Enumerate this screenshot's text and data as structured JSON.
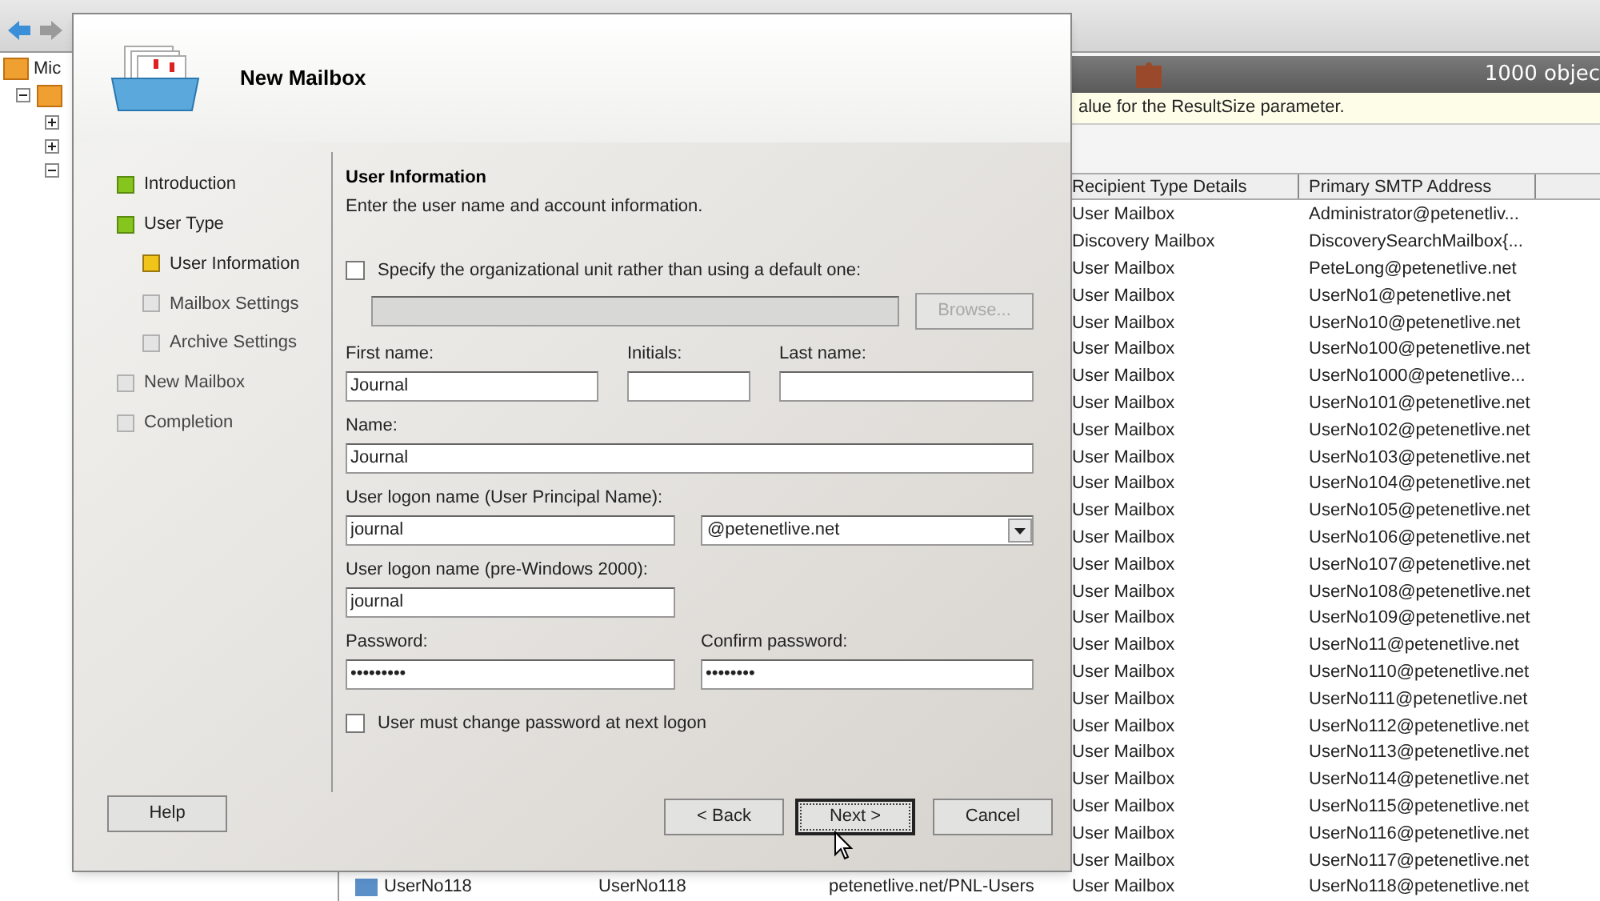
{
  "tree": {
    "root_label": "Mic",
    "nodes": [
      {
        "expanded": true
      },
      {
        "expanded": false
      },
      {
        "expanded": false
      },
      {
        "expanded": true
      }
    ]
  },
  "results": {
    "count": "1000 objec",
    "info": "alue for the ResultSize parameter.",
    "columns": [
      "Recipient Type Details",
      "Primary SMTP Address"
    ],
    "rows": [
      {
        "type": "User Mailbox",
        "smtp": "Administrator@petenetliv..."
      },
      {
        "type": "Discovery Mailbox",
        "smtp": "DiscoverySearchMailbox{..."
      },
      {
        "type": "User Mailbox",
        "smtp": "PeteLong@petenetlive.net"
      },
      {
        "type": "User Mailbox",
        "smtp": "UserNo1@petenetlive.net"
      },
      {
        "type": "User Mailbox",
        "smtp": "UserNo10@petenetlive.net"
      },
      {
        "type": "User Mailbox",
        "smtp": "UserNo100@petenetlive.net"
      },
      {
        "type": "User Mailbox",
        "smtp": "UserNo1000@petenetlive..."
      },
      {
        "type": "User Mailbox",
        "smtp": "UserNo101@petenetlive.net"
      },
      {
        "type": "User Mailbox",
        "smtp": "UserNo102@petenetlive.net"
      },
      {
        "type": "User Mailbox",
        "smtp": "UserNo103@petenetlive.net"
      },
      {
        "type": "User Mailbox",
        "smtp": "UserNo104@petenetlive.net"
      },
      {
        "type": "User Mailbox",
        "smtp": "UserNo105@petenetlive.net"
      },
      {
        "type": "User Mailbox",
        "smtp": "UserNo106@petenetlive.net"
      },
      {
        "type": "User Mailbox",
        "smtp": "UserNo107@petenetlive.net"
      },
      {
        "type": "User Mailbox",
        "smtp": "UserNo108@petenetlive.net"
      },
      {
        "type": "User Mailbox",
        "smtp": "UserNo109@petenetlive.net"
      },
      {
        "type": "User Mailbox",
        "smtp": "UserNo11@petenetlive.net"
      },
      {
        "type": "User Mailbox",
        "smtp": "UserNo110@petenetlive.net"
      },
      {
        "type": "User Mailbox",
        "smtp": "UserNo111@petenetlive.net"
      },
      {
        "type": "User Mailbox",
        "smtp": "UserNo112@petenetlive.net"
      },
      {
        "type": "User Mailbox",
        "smtp": "UserNo113@petenetlive.net"
      },
      {
        "type": "User Mailbox",
        "smtp": "UserNo114@petenetlive.net"
      },
      {
        "type": "User Mailbox",
        "smtp": "UserNo115@petenetlive.net"
      },
      {
        "type": "User Mailbox",
        "smtp": "UserNo116@petenetlive.net"
      },
      {
        "type": "User Mailbox",
        "smtp": "UserNo117@petenetlive.net"
      },
      {
        "name": "UserNo118",
        "alias": "UserNo118",
        "ou": "petenetlive.net/PNL-Users",
        "type": "User Mailbox",
        "smtp": "UserNo118@petenetlive.net"
      }
    ]
  },
  "dialog": {
    "title": "New Mailbox",
    "steps": [
      {
        "label": "Introduction",
        "completed": true,
        "selected": false
      },
      {
        "label": "User Type",
        "completed": true,
        "selected": false,
        "children": [
          {
            "label": "User Information",
            "completed": false,
            "selected": true
          },
          {
            "label": "Mailbox Settings",
            "completed": false,
            "selected": false
          },
          {
            "label": "Archive Settings",
            "completed": false,
            "selected": false
          }
        ]
      },
      {
        "label": "New Mailbox",
        "completed": false,
        "selected": false
      },
      {
        "label": "Completion",
        "completed": false,
        "selected": false
      }
    ],
    "section_title": "User Information",
    "section_description": "Enter the user name and account information.",
    "ou_checkbox": {
      "label": "Specify the organizational unit rather than using a default one:",
      "checked": false
    },
    "browse_button": {
      "label": "Browse...",
      "disabled": true
    },
    "first_name": {
      "label": "First name:",
      "value": "Journal"
    },
    "initials": {
      "label": "Initials:"
    },
    "last_name": {
      "label": "Last name:"
    },
    "name": {
      "label": "Name:",
      "value": "Journal"
    },
    "upn": {
      "label": "User logon name (User Principal Name):",
      "value": "journal"
    },
    "domain": {
      "value": "@petenetlive.net"
    },
    "pre2000": {
      "label": "User logon name (pre-Windows 2000):",
      "value": "journal"
    },
    "password": {
      "label": "Password:",
      "value": "•••••••••"
    },
    "confirm_password": {
      "label": "Confirm password:",
      "value": "••••••••"
    },
    "change_checkbox": {
      "label": "User must change password at next logon",
      "checked": false
    },
    "buttons": {
      "help": {
        "label": "Help",
        "focused": false
      },
      "back": {
        "label": "< Back",
        "focused": false
      },
      "next": {
        "label": "Next >",
        "focused": true
      },
      "cancel": {
        "label": "Cancel",
        "focused": false
      }
    }
  }
}
